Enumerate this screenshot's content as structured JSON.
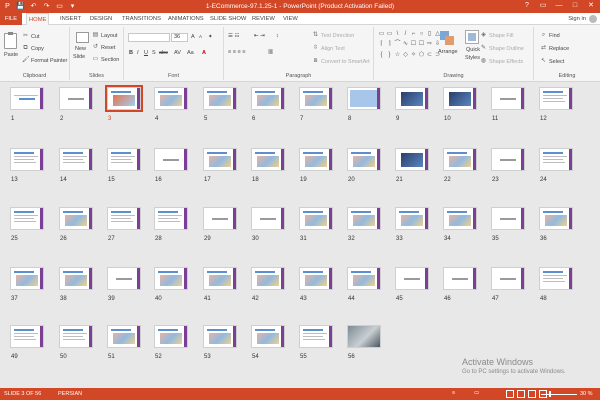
{
  "window": {
    "title": "1-ECommerce-97.1.25-1 - PowerPoint (Product Activation Failed)",
    "controls": [
      "?",
      "▭",
      "—",
      "□",
      "✕"
    ]
  },
  "qat": [
    "P",
    "💾",
    "↶",
    "↷",
    "▭",
    "▾"
  ],
  "tabs": [
    "FILE",
    "HOME",
    "INSERT",
    "DESIGN",
    "TRANSITIONS",
    "ANIMATIONS",
    "SLIDE SHOW",
    "REVIEW",
    "VIEW"
  ],
  "active_tab": "HOME",
  "signin": "Sign in",
  "ribbon": {
    "clipboard": {
      "label": "Clipboard",
      "paste": "Paste",
      "cut": "Cut",
      "copy": "Copy",
      "format_painter": "Format Painter"
    },
    "slides": {
      "label": "Slides",
      "new_slide": "New",
      "new_slide_2": "Slide",
      "layout": "Layout",
      "reset": "Reset",
      "section": "Section"
    },
    "font": {
      "label": "Font",
      "size": "36",
      "grow": "A",
      "shrink": "A",
      "bold": "B",
      "italic": "I",
      "underline": "U",
      "strike": "S",
      "abc": "abc",
      "av": "AV",
      "aa": "Aa",
      "color": "A"
    },
    "paragraph": {
      "label": "Paragraph",
      "text_direction": "Text Direction",
      "align_text": "Align Text",
      "convert_smartart": "Convert to SmartArt"
    },
    "drawing": {
      "label": "Drawing",
      "arrange": "Arrange",
      "quick": "Quick",
      "styles": "Styles",
      "shape_fill": "Shape Fill",
      "shape_outline": "Shape Outline",
      "shape_effects": "Shape Effects"
    },
    "editing": {
      "label": "Editing",
      "find": "Find",
      "replace": "Replace",
      "select": "Select"
    }
  },
  "shapes_glyphs": [
    "▭",
    "▭",
    "\\",
    "/",
    "⌐",
    "○",
    "▯",
    "△",
    "⌈",
    "⌉",
    "⌒",
    "∿",
    "☐",
    "☐",
    "⇨",
    "⇩",
    "{",
    "}",
    "☆",
    "◇",
    "✧",
    "⬠",
    "⊂",
    "⊃"
  ],
  "slides_grid": {
    "total": 56,
    "selected": 3,
    "types": [
      "title",
      "blank",
      "selected",
      "pics",
      "pics",
      "pics",
      "pics",
      "blue",
      "dark",
      "dark",
      "blank",
      "text",
      "text",
      "text",
      "text",
      "blank",
      "pics",
      "pics",
      "pics",
      "pics",
      "dark",
      "pics",
      "blank",
      "text",
      "text",
      "pics",
      "text",
      "text",
      "blank",
      "blank",
      "pics",
      "pics",
      "pics",
      "pics",
      "blank",
      "pics",
      "pics",
      "pics",
      "blank",
      "pics",
      "pics",
      "pics",
      "pics",
      "pics",
      "blank",
      "blank",
      "blank",
      "text",
      "text",
      "text",
      "pics",
      "pics",
      "pics",
      "pics",
      "text",
      "photo"
    ]
  },
  "watermark": {
    "line1": "Activate Windows",
    "line2": "Go to PC settings to activate Windows."
  },
  "status": {
    "slide": "SLIDE 3 OF 56",
    "language": "PERSIAN",
    "notes": "≡",
    "comments": "▭",
    "zoom": "30 %"
  },
  "colors": {
    "accent": "#d24726",
    "slide_bar": "#7b3f96",
    "slide_header": "#5b8fd0"
  }
}
